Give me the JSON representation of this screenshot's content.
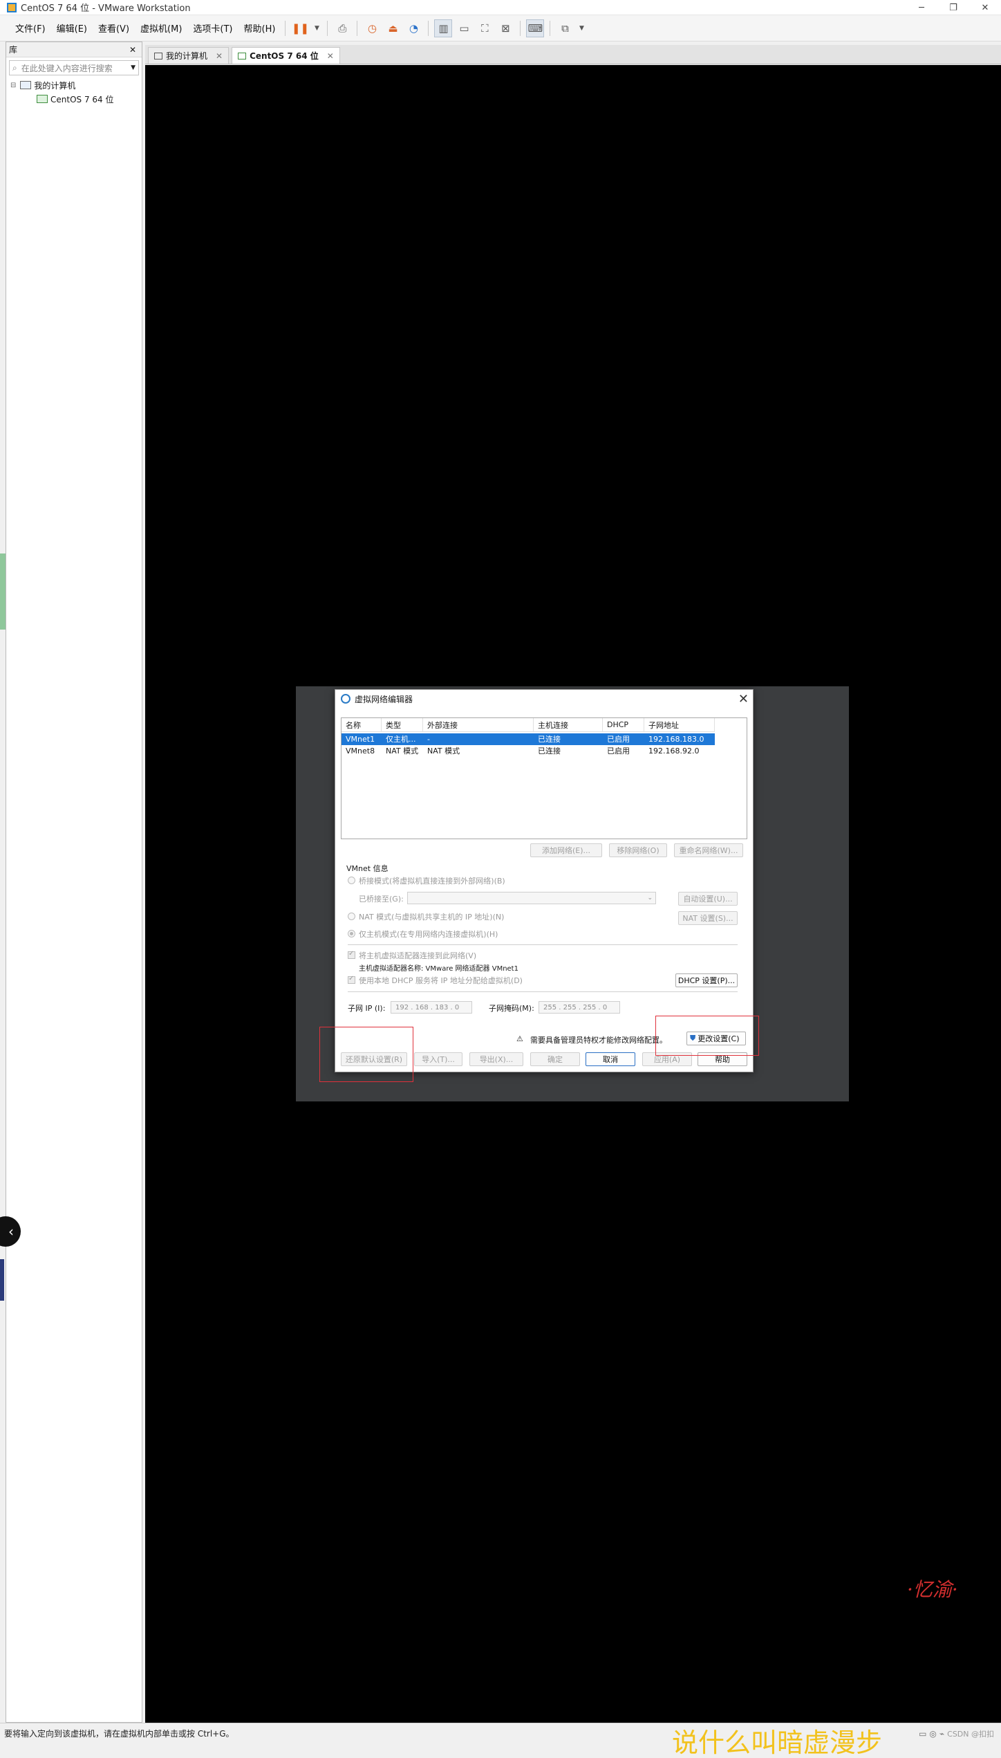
{
  "window": {
    "title": "CentOS 7 64 位 - VMware Workstation"
  },
  "menu": [
    "文件(F)",
    "编辑(E)",
    "查看(V)",
    "虚拟机(M)",
    "选项卡(T)",
    "帮助(H)"
  ],
  "library": {
    "title": "库",
    "search_placeholder": "在此处键入内容进行搜索",
    "tree": {
      "root": "我的计算机",
      "child": "CentOS 7 64 位"
    }
  },
  "tabs": [
    {
      "label": "我的计算机"
    },
    {
      "label": "CentOS 7 64 位"
    }
  ],
  "dialog": {
    "title": "虚拟网络编辑器",
    "columns": [
      "名称",
      "类型",
      "外部连接",
      "主机连接",
      "DHCP",
      "子网地址"
    ],
    "rows": [
      {
        "name": "VMnet1",
        "type": "仅主机...",
        "external": "-",
        "host": "已连接",
        "dhcp": "已启用",
        "subnet": "192.168.183.0"
      },
      {
        "name": "VMnet8",
        "type": "NAT 模式",
        "external": "NAT 模式",
        "host": "已连接",
        "dhcp": "已启用",
        "subnet": "192.168.92.0"
      }
    ],
    "list_buttons": {
      "add": "添加网络(E)...",
      "remove": "移除网络(O)",
      "rename": "重命名网络(W)..."
    },
    "vmnet_info_label": "VMnet 信息",
    "bridged_label": "桥接模式(将虚拟机直接连接到外部网络)(B)",
    "bridged_to_label": "已桥接至(G):",
    "auto_settings": "自动设置(U)...",
    "nat_label": "NAT 模式(与虚拟机共享主机的 IP 地址)(N)",
    "nat_settings": "NAT 设置(S)...",
    "hostonly_label": "仅主机模式(在专用网络内连接虚拟机)(H)",
    "connect_adapter_label": "将主机虚拟适配器连接到此网络(V)",
    "adapter_name_label": "主机虚拟适配器名称: VMware 网络适配器 VMnet1",
    "dhcp_label": "使用本地 DHCP 服务将 IP 地址分配给虚拟机(D)",
    "dhcp_settings": "DHCP 设置(P)...",
    "subnet_ip_label": "子网 IP (I):",
    "subnet_ip_value": "192 . 168 . 183 .  0",
    "subnet_mask_label": "子网掩码(M):",
    "subnet_mask_value": "255 . 255 . 255 .  0",
    "admin_warning": "需要具备管理员特权才能修改网络配置。",
    "change_settings": "更改设置(C)",
    "buttons": {
      "restore": "还原默认设置(R)",
      "import": "导入(T)...",
      "export": "导出(X)...",
      "ok": "确定",
      "cancel": "取消",
      "apply": "应用(A)",
      "help": "帮助"
    }
  },
  "status_bar": {
    "text": "要将输入定向到该虚拟机，请在虚拟机内部单击或按 Ctrl+G。",
    "csdn": "CSDN @扣扣"
  },
  "bottom_caption": "说什么叫暗虚漫步",
  "watermark": "·忆渝·",
  "colors": {
    "selection": "#1e78d7",
    "annotation_red": "#e0313b",
    "caption_yellow": "#f2c21d"
  }
}
